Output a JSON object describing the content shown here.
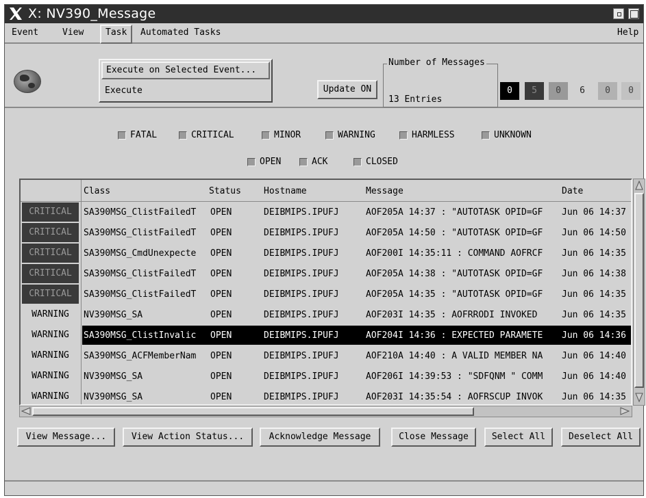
{
  "window": {
    "title": "X: NV390_Message"
  },
  "menubar": {
    "items": [
      "Event",
      "View",
      "Task",
      "Automated Tasks"
    ],
    "help": "Help"
  },
  "task_menu": {
    "items": [
      "Execute on Selected Event...",
      "Execute"
    ]
  },
  "toolbar": {
    "update_button": "Update ON",
    "message_count_label": "Number of Messages",
    "message_count_value": "13 Entries",
    "counters": [
      "0",
      "5",
      "0",
      "6",
      "0",
      "0"
    ]
  },
  "filters": {
    "severity": [
      "FATAL",
      "CRITICAL",
      "MINOR",
      "WARNING",
      "HARMLESS",
      "UNKNOWN"
    ],
    "state": [
      "OPEN",
      "ACK",
      "CLOSED"
    ]
  },
  "table": {
    "columns": [
      "Class",
      "Status",
      "Hostname",
      "Message",
      "Date"
    ],
    "rows": [
      {
        "severity": "CRITICAL",
        "class": "SA390MSG_ClistFailedT",
        "status": "OPEN",
        "hostname": "DEIBMIPS.IPUFJ",
        "message": "AOF205A 14:37 : \"AUTOTASK OPID=GF",
        "date": "Jun 06 14:37"
      },
      {
        "severity": "CRITICAL",
        "class": "SA390MSG_ClistFailedT",
        "status": "OPEN",
        "hostname": "DEIBMIPS.IPUFJ",
        "message": "AOF205A 14:50 : \"AUTOTASK OPID=GF",
        "date": "Jun 06 14:50"
      },
      {
        "severity": "CRITICAL",
        "class": "SA390MSG_CmdUnexpecte",
        "status": "OPEN",
        "hostname": "DEIBMIPS.IPUFJ",
        "message": "AOF200I 14:35:11 : COMMAND AOFRCF",
        "date": "Jun 06 14:35"
      },
      {
        "severity": "CRITICAL",
        "class": "SA390MSG_ClistFailedT",
        "status": "OPEN",
        "hostname": "DEIBMIPS.IPUFJ",
        "message": "AOF205A 14:38 : \"AUTOTASK OPID=GF",
        "date": "Jun 06 14:38"
      },
      {
        "severity": "CRITICAL",
        "class": "SA390MSG_ClistFailedT",
        "status": "OPEN",
        "hostname": "DEIBMIPS.IPUFJ",
        "message": "AOF205A 14:35 : \"AUTOTASK OPID=GF",
        "date": "Jun 06 14:35"
      },
      {
        "severity": "WARNING",
        "class": "NV390MSG_SA",
        "status": "OPEN",
        "hostname": "DEIBMIPS.IPUFJ",
        "message": "AOF203I 14:35 : AOFRRODI INVOKED",
        "date": "Jun 06 14:35"
      },
      {
        "severity": "WARNING",
        "class": "SA390MSG_ClistInvalic",
        "status": "OPEN",
        "hostname": "DEIBMIPS.IPUFJ",
        "message": "AOF204I 14:36 : EXPECTED PARAMETE",
        "date": "Jun 06 14:36",
        "selected": true
      },
      {
        "severity": "WARNING",
        "class": "SA390MSG_ACFMemberNam",
        "status": "OPEN",
        "hostname": "DEIBMIPS.IPUFJ",
        "message": "AOF210A 14:40 : A VALID MEMBER NA",
        "date": "Jun 06 14:40"
      },
      {
        "severity": "WARNING",
        "class": "NV390MSG_SA",
        "status": "OPEN",
        "hostname": "DEIBMIPS.IPUFJ",
        "message": "AOF206I 14:39:53 : \"SDFQNM \" COMM",
        "date": "Jun 06 14:40"
      },
      {
        "severity": "WARNING",
        "class": "NV390MSG_SA",
        "status": "OPEN",
        "hostname": "DEIBMIPS.IPUFJ",
        "message": "AOF203I 14:35:54 : AOFRSCUP INVOK",
        "date": "Jun 06 14:35"
      }
    ]
  },
  "buttons": {
    "view_message": "View Message...",
    "view_action_status": "View Action Status...",
    "acknowledge": "Acknowledge Message",
    "close": "Close Message",
    "select_all": "Select All",
    "deselect_all": "Deselect All"
  },
  "colors": {
    "title_bar": "#2f2f2f",
    "critical_bg": "#3a3a3a",
    "selected_row": "#000000",
    "window_bg": "#d2d2d2"
  }
}
